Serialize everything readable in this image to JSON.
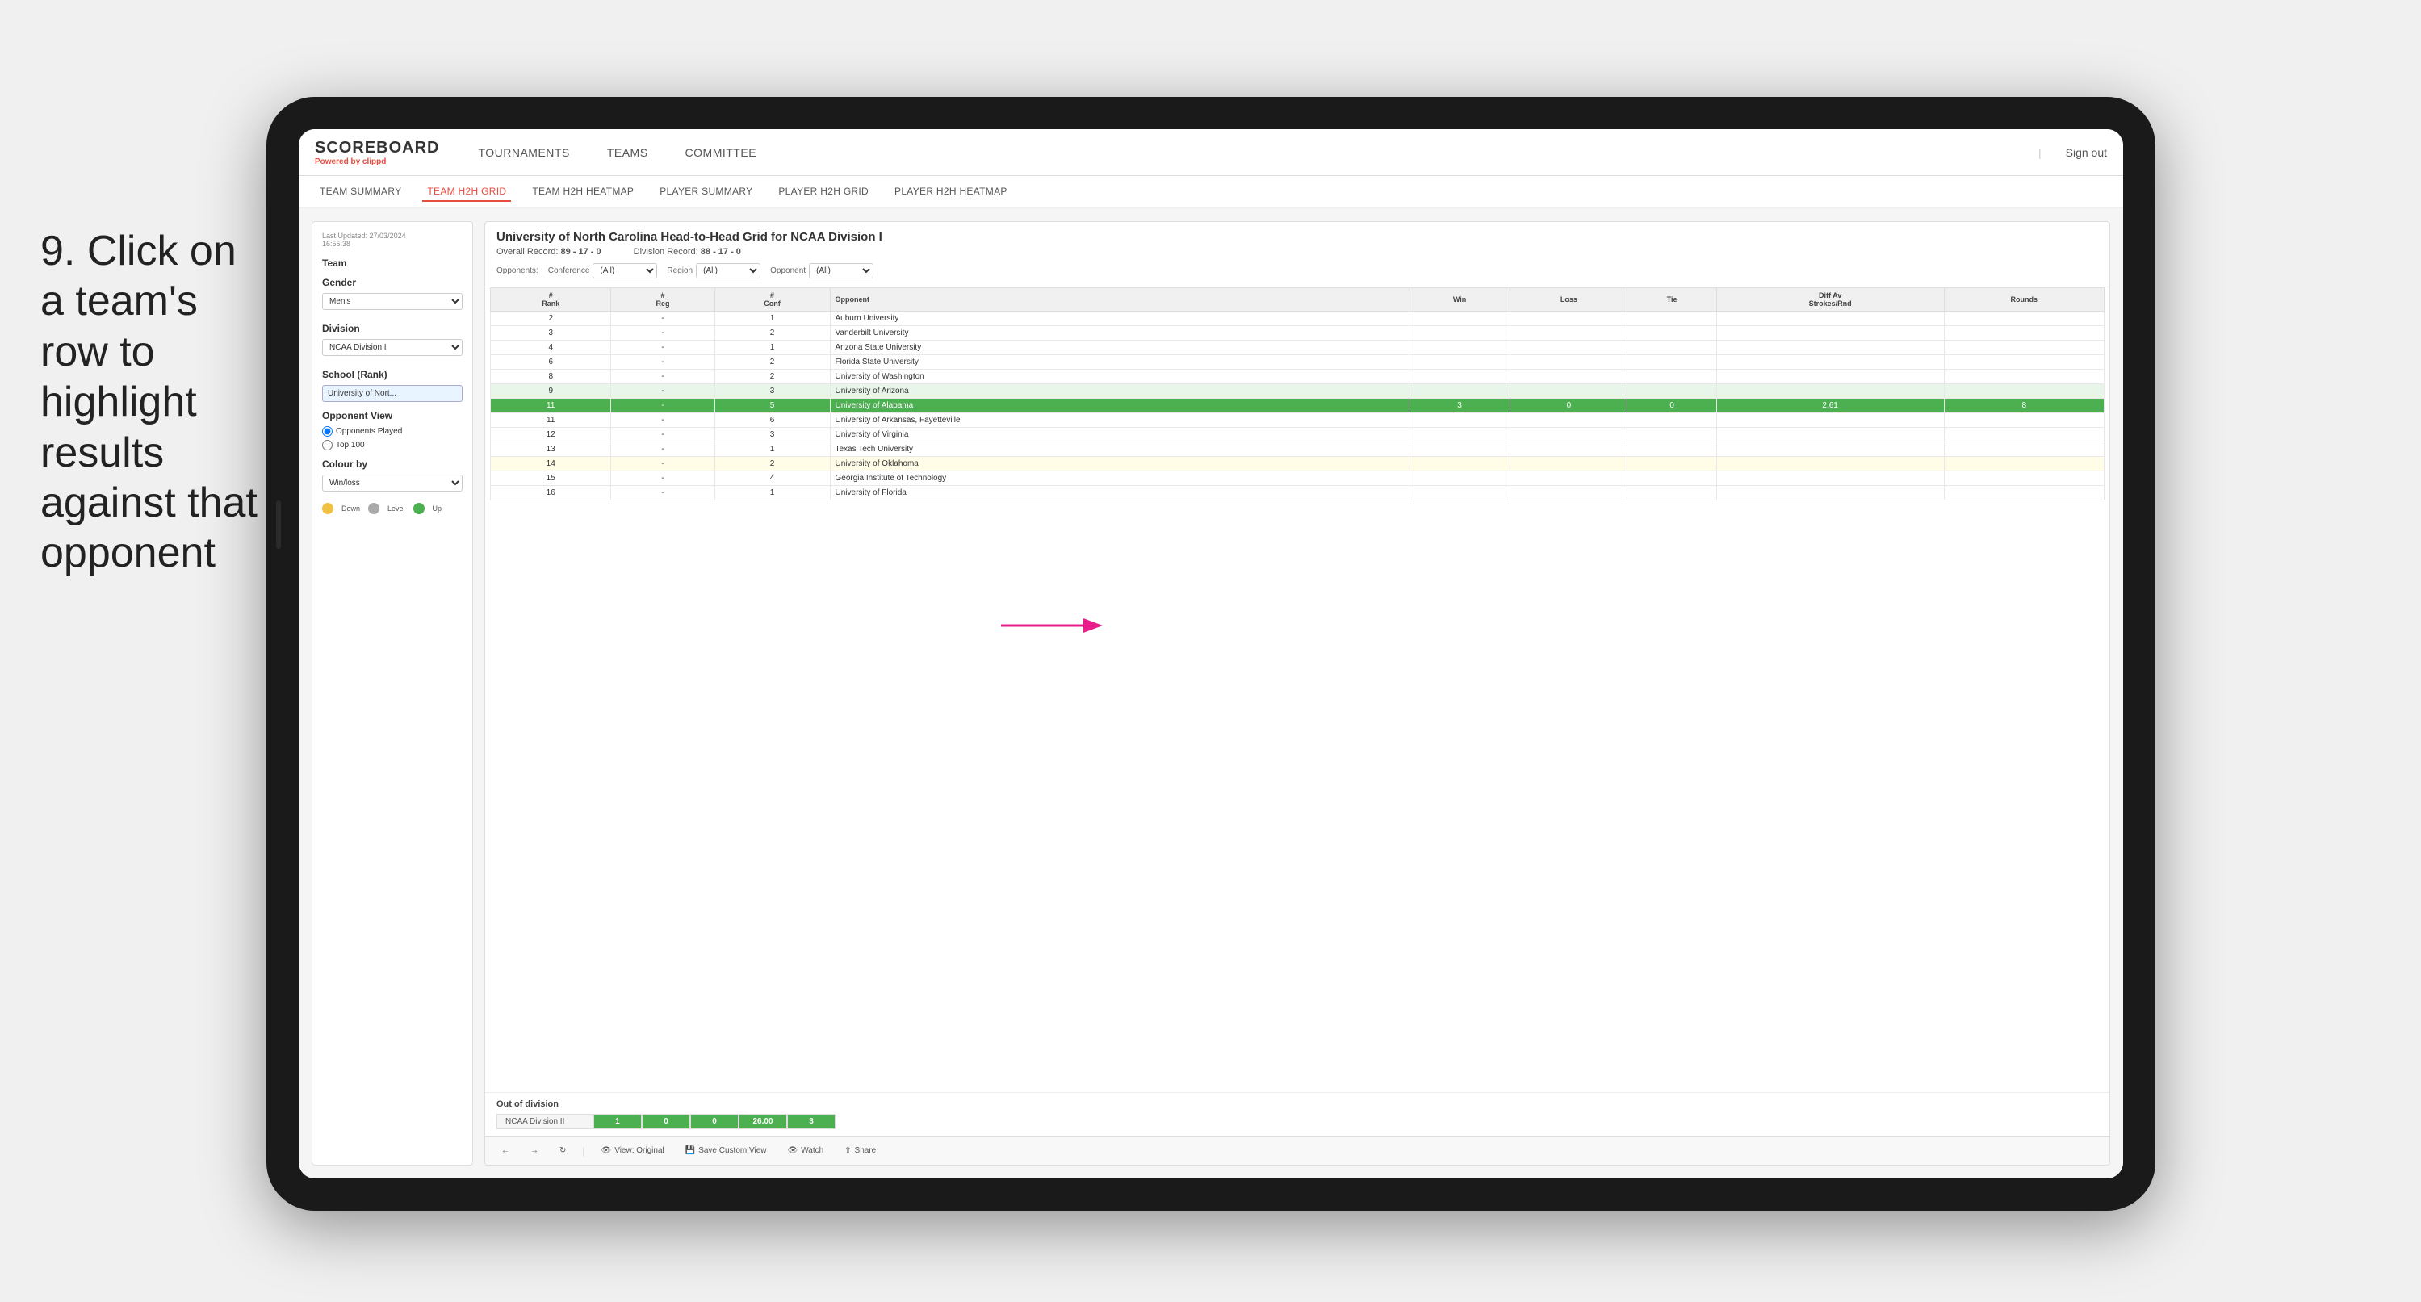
{
  "instruction": {
    "number": "9.",
    "text": "Click on a team's row to highlight results against that opponent"
  },
  "nav": {
    "logo": "SCOREBOARD",
    "powered_by": "Powered by",
    "brand": "clippd",
    "items": [
      "TOURNAMENTS",
      "TEAMS",
      "COMMITTEE"
    ],
    "sign_out": "Sign out"
  },
  "sub_nav": {
    "items": [
      "TEAM SUMMARY",
      "TEAM H2H GRID",
      "TEAM H2H HEATMAP",
      "PLAYER SUMMARY",
      "PLAYER H2H GRID",
      "PLAYER H2H HEATMAP"
    ],
    "active": "TEAM H2H GRID"
  },
  "left_panel": {
    "last_updated_label": "Last Updated: 27/03/2024",
    "time": "16:55:38",
    "team_label": "Team",
    "gender_label": "Gender",
    "gender_value": "Men's",
    "division_label": "Division",
    "division_value": "NCAA Division I",
    "school_label": "School (Rank)",
    "school_value": "University of Nort...",
    "opponent_view_label": "Opponent View",
    "radio1": "Opponents Played",
    "radio2": "Top 100",
    "colour_by_label": "Colour by",
    "colour_by_value": "Win/loss",
    "legend": [
      {
        "color": "#f0c040",
        "label": "Down"
      },
      {
        "color": "#aaaaaa",
        "label": "Level"
      },
      {
        "color": "#4caf50",
        "label": "Up"
      }
    ]
  },
  "grid": {
    "title": "University of North Carolina Head-to-Head Grid for NCAA Division I",
    "overall_record_label": "Overall Record:",
    "overall_record_value": "89 - 17 - 0",
    "division_record_label": "Division Record:",
    "division_record_value": "88 - 17 - 0",
    "filters": {
      "opponents_label": "Opponents:",
      "conference_label": "Conference",
      "conference_value": "(All)",
      "region_label": "Region",
      "region_value": "(All)",
      "opponent_label": "Opponent",
      "opponent_value": "(All)"
    },
    "columns": [
      "#\nRank",
      "#\nReg",
      "#\nConf",
      "Opponent",
      "Win",
      "Loss",
      "Tie",
      "Diff Av\nStrokes/Rnd",
      "Rounds"
    ],
    "rows": [
      {
        "rank": "2",
        "reg": "-",
        "conf": "1",
        "opponent": "Auburn University",
        "win": "",
        "loss": "",
        "tie": "",
        "diff": "",
        "rounds": "",
        "style": "plain"
      },
      {
        "rank": "3",
        "reg": "-",
        "conf": "2",
        "opponent": "Vanderbilt University",
        "win": "",
        "loss": "",
        "tie": "",
        "diff": "",
        "rounds": "",
        "style": "plain"
      },
      {
        "rank": "4",
        "reg": "-",
        "conf": "1",
        "opponent": "Arizona State University",
        "win": "",
        "loss": "",
        "tie": "",
        "diff": "",
        "rounds": "",
        "style": "plain"
      },
      {
        "rank": "6",
        "reg": "-",
        "conf": "2",
        "opponent": "Florida State University",
        "win": "",
        "loss": "",
        "tie": "",
        "diff": "",
        "rounds": "",
        "style": "plain"
      },
      {
        "rank": "8",
        "reg": "-",
        "conf": "2",
        "opponent": "University of Washington",
        "win": "",
        "loss": "",
        "tie": "",
        "diff": "",
        "rounds": "",
        "style": "plain"
      },
      {
        "rank": "9",
        "reg": "-",
        "conf": "3",
        "opponent": "University of Arizona",
        "win": "",
        "loss": "",
        "tie": "",
        "diff": "",
        "rounds": "",
        "style": "green-light"
      },
      {
        "rank": "11",
        "reg": "-",
        "conf": "5",
        "opponent": "University of Alabama",
        "win": "3",
        "loss": "0",
        "tie": "0",
        "diff": "2.61",
        "rounds": "8",
        "style": "highlighted"
      },
      {
        "rank": "11",
        "reg": "-",
        "conf": "6",
        "opponent": "University of Arkansas, Fayetteville",
        "win": "",
        "loss": "",
        "tie": "",
        "diff": "",
        "rounds": "",
        "style": "plain"
      },
      {
        "rank": "12",
        "reg": "-",
        "conf": "3",
        "opponent": "University of Virginia",
        "win": "",
        "loss": "",
        "tie": "",
        "diff": "",
        "rounds": "",
        "style": "plain"
      },
      {
        "rank": "13",
        "reg": "-",
        "conf": "1",
        "opponent": "Texas Tech University",
        "win": "",
        "loss": "",
        "tie": "",
        "diff": "",
        "rounds": "",
        "style": "plain"
      },
      {
        "rank": "14",
        "reg": "-",
        "conf": "2",
        "opponent": "University of Oklahoma",
        "win": "",
        "loss": "",
        "tie": "",
        "diff": "",
        "rounds": "",
        "style": "yellow-light"
      },
      {
        "rank": "15",
        "reg": "-",
        "conf": "4",
        "opponent": "Georgia Institute of Technology",
        "win": "",
        "loss": "",
        "tie": "",
        "diff": "",
        "rounds": "",
        "style": "plain"
      },
      {
        "rank": "16",
        "reg": "-",
        "conf": "1",
        "opponent": "University of Florida",
        "win": "",
        "loss": "",
        "tie": "",
        "diff": "",
        "rounds": "",
        "style": "plain"
      }
    ],
    "out_of_division": {
      "title": "Out of division",
      "label": "NCAA Division II",
      "win": "1",
      "loss": "0",
      "tie": "0",
      "diff": "26.00",
      "rounds": "3"
    }
  },
  "toolbar": {
    "view_label": "View: Original",
    "save_label": "Save Custom View",
    "watch_label": "Watch",
    "share_label": "Share"
  }
}
